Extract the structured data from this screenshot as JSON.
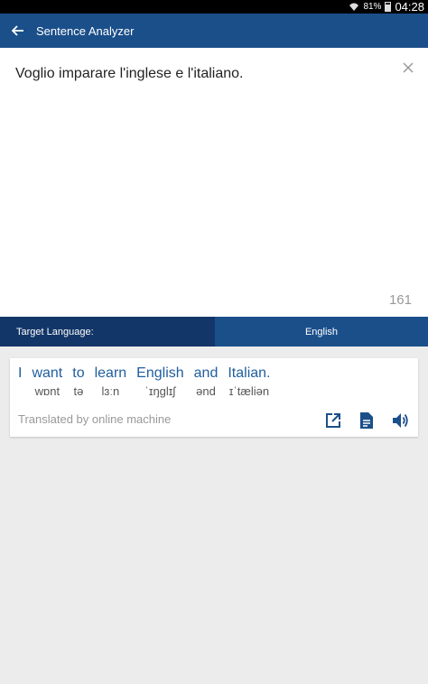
{
  "status_bar": {
    "battery": "81%",
    "time": "04:28"
  },
  "app_bar": {
    "title": "Sentence Analyzer",
    "back_icon": "arrow-back-icon"
  },
  "input": {
    "text": "Voglio imparare l'inglese e l'italiano.",
    "clear_icon": "close-icon",
    "char_count": "161"
  },
  "target_language": {
    "label": "Target Language:",
    "value": "English"
  },
  "result": {
    "words": [
      {
        "word": "I",
        "phonetic": ""
      },
      {
        "word": "want",
        "phonetic": "wɒnt"
      },
      {
        "word": "to",
        "phonetic": "tə"
      },
      {
        "word": "learn",
        "phonetic": "lɜːn"
      },
      {
        "word": "English",
        "phonetic": "ˈɪŋglɪʃ"
      },
      {
        "word": "and",
        "phonetic": "ənd"
      },
      {
        "word": "Italian.",
        "phonetic": "ɪˈtæliən"
      }
    ],
    "note": "Translated by online machine",
    "actions": [
      "open-external-icon",
      "document-icon",
      "speaker-icon"
    ]
  },
  "colors": {
    "app_bar": "#1b4f8a",
    "target_label_bg": "#133668",
    "word_color": "#1f5e9e"
  }
}
